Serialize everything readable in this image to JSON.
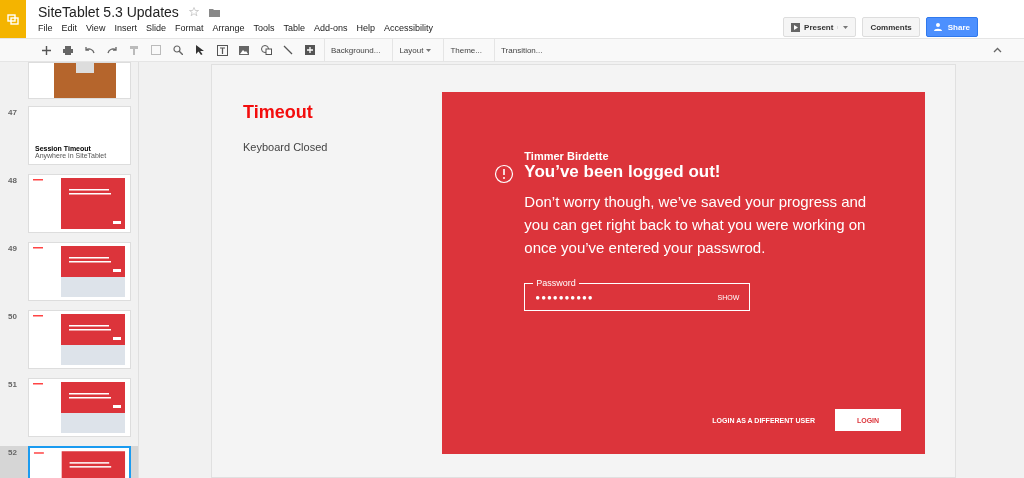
{
  "app": {
    "title": "SiteTablet 5.3 Updates"
  },
  "menu": [
    "File",
    "Edit",
    "View",
    "Insert",
    "Slide",
    "Format",
    "Arrange",
    "Tools",
    "Table",
    "Add-ons",
    "Help",
    "Accessibility"
  ],
  "header_buttons": [
    {
      "kind": "present",
      "label": "Present"
    },
    {
      "kind": "plain",
      "label": "Comments"
    },
    {
      "kind": "share",
      "label": "Share"
    }
  ],
  "toolbar_buttons": [
    {
      "label": "Background...",
      "dropdown": false
    },
    {
      "label": "Layout",
      "dropdown": true
    },
    {
      "label": "Theme...",
      "dropdown": false
    },
    {
      "label": "Transition...",
      "dropdown": false
    }
  ],
  "slides": [
    {
      "kind": "photo",
      "selected": false
    },
    {
      "number": "47",
      "kind": "title",
      "title": "Session Timeout",
      "subtitle": "Anywhere in SiteTablet",
      "selected": false
    },
    {
      "number": "48",
      "kind": "dialog",
      "selected": false
    },
    {
      "number": "49",
      "kind": "keyboard",
      "selected": false
    },
    {
      "number": "50",
      "kind": "keyboard",
      "selected": false
    },
    {
      "number": "51",
      "kind": "keyboard",
      "selected": false
    },
    {
      "number": "52",
      "kind": "dialog",
      "selected": true
    }
  ],
  "slide": {
    "title": "Timeout",
    "subtitle": "Keyboard Closed",
    "dialog": {
      "user": "Timmer Birdette",
      "heading": "You’ve been logged out!",
      "message": "Don’t worry though, we’ve saved your progress and you can get right back to what you were working on once you’ve entered your passwrod.",
      "password": {
        "label": "Password",
        "value": "●●●●●●●●●●",
        "toggle": "SHOW"
      },
      "secondary_button": "LOGIN AS A DIFFERENT USER",
      "primary_button": "LOGIN"
    }
  }
}
